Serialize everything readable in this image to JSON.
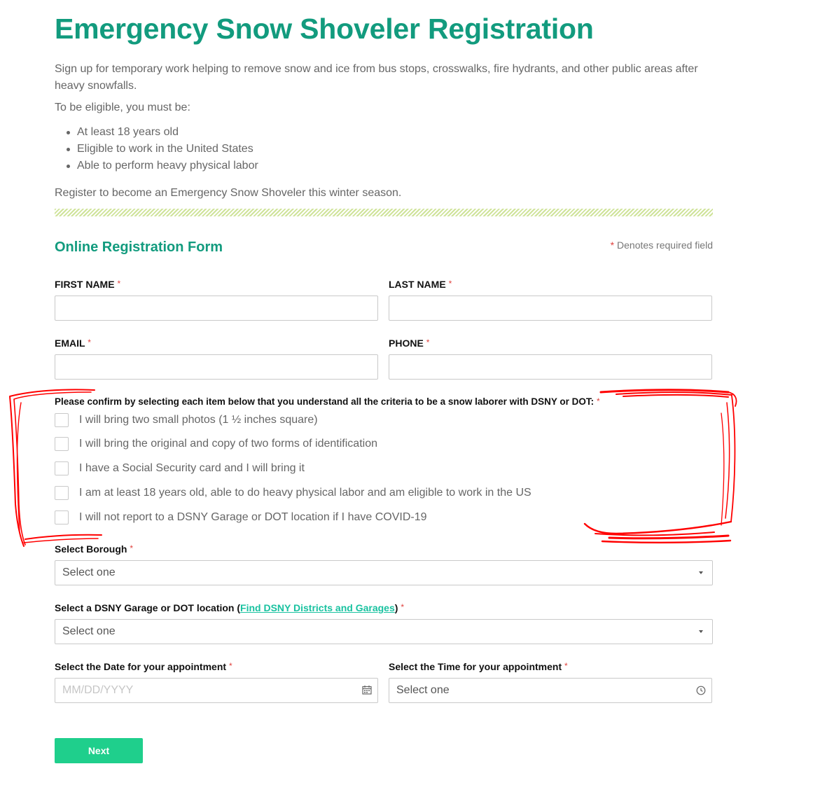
{
  "header": {
    "title": "Emergency Snow Shoveler Registration",
    "intro": "Sign up for temporary work helping to remove snow and ice from bus stops, crosswalks, fire hydrants, and other public areas after heavy snowfalls.",
    "eligibility_lead": "To be eligible, you must be:",
    "requirements": [
      "At least 18 years old",
      "Eligible to work in the United States",
      "Able to perform heavy physical labor"
    ],
    "register_text": "Register to become an Emergency Snow Shoveler this winter season."
  },
  "form": {
    "title": "Online Registration Form",
    "required_note": "Denotes required field",
    "required_marker": "*",
    "first_name": {
      "label": "FIRST NAME",
      "value": ""
    },
    "last_name": {
      "label": "LAST NAME",
      "value": ""
    },
    "email": {
      "label": "EMAIL",
      "value": ""
    },
    "phone": {
      "label": "PHONE",
      "value": ""
    },
    "confirm_prompt": "Please confirm by selecting each item below that you understand all the criteria to be a snow laborer with DSNY or DOT:",
    "confirm_items": [
      {
        "label": "I will bring two small photos (1 ½ inches square)",
        "checked": false
      },
      {
        "label": "I will bring the original and copy of two forms of identification",
        "checked": false
      },
      {
        "label": "I have a Social Security card and I will bring it",
        "checked": false
      },
      {
        "label": "I am at least 18 years old, able to do heavy physical labor and am eligible to work in the US",
        "checked": false
      },
      {
        "label": "I will not report to a DSNY Garage or DOT location if I have COVID-19",
        "checked": false
      }
    ],
    "borough": {
      "label": "Select Borough",
      "selected": "Select one"
    },
    "location": {
      "label_prefix": "Select a DSNY Garage or DOT location (",
      "link_text": "Find DSNY Districts and Garages",
      "label_suffix": ")",
      "selected": "Select one"
    },
    "date": {
      "label": "Select the Date for your appointment",
      "placeholder": "MM/DD/YYYY"
    },
    "time": {
      "label": "Select the Time for your appointment",
      "selected": "Select one"
    },
    "next_button": "Next"
  },
  "colors": {
    "brand_green": "#129b7e",
    "button_green": "#1fcf8c",
    "link_teal": "#19c2a0",
    "required_red": "#e0423e",
    "annotation_red": "#ff0000"
  }
}
